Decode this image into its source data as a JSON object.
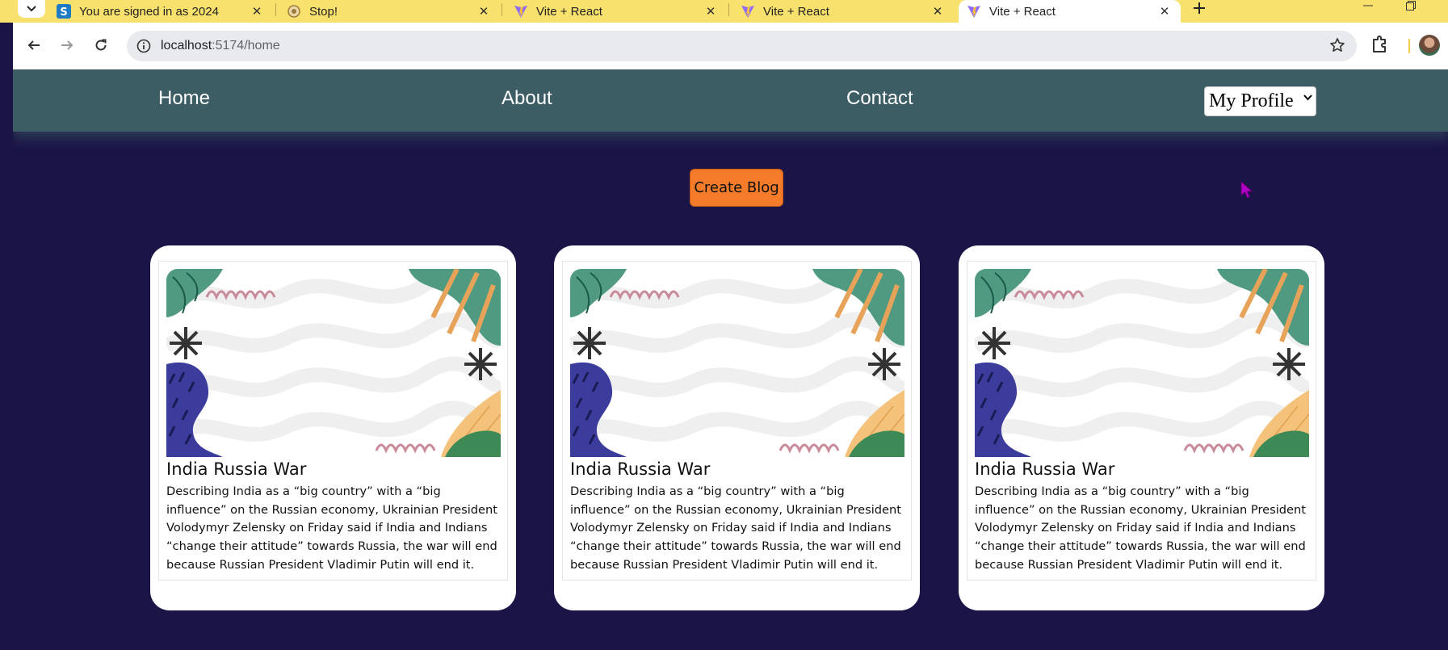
{
  "browser": {
    "tabs": [
      {
        "title": "You are signed in as 2024",
        "favicon": "s-icon",
        "active": false
      },
      {
        "title": "Stop!",
        "favicon": "stop-icon",
        "active": false
      },
      {
        "title": "Vite + React",
        "favicon": "vite-icon",
        "active": false
      },
      {
        "title": "Vite + React",
        "favicon": "vite-icon",
        "active": false
      },
      {
        "title": "Vite + React",
        "favicon": "vite-icon",
        "active": true
      }
    ],
    "url_host": "localhost",
    "url_path": ":5174/home",
    "accent_color": "#f8e16c"
  },
  "nav": {
    "home": "Home",
    "about": "About",
    "contact": "Contact",
    "profile_select": "My Profile",
    "bg_color": "#3c5d63"
  },
  "main": {
    "create_button": "Create Blog",
    "bg_color": "#1b1547",
    "button_color": "#f47b2a"
  },
  "cards": [
    {
      "title": "India Russia War",
      "description": "Describing India as a “big country” with a “big influence” on the Russian economy, Ukrainian President Volodymyr Zelensky on Friday said if India and Indians “change their attitude” towards Russia, the war will end because Russian President Vladimir Putin will end it."
    },
    {
      "title": "India Russia War",
      "description": "Describing India as a “big country” with a “big influence” on the Russian economy, Ukrainian President Volodymyr Zelensky on Friday said if India and Indians “change their attitude” towards Russia, the war will end because Russian President Vladimir Putin will end it."
    },
    {
      "title": "India Russia War",
      "description": "Describing India as a “big country” with a “big influence” on the Russian economy, Ukrainian President Volodymyr Zelensky on Friday said if India and Indians “change their attitude” towards Russia, the war will end because Russian President Vladimir Putin will end it."
    }
  ]
}
